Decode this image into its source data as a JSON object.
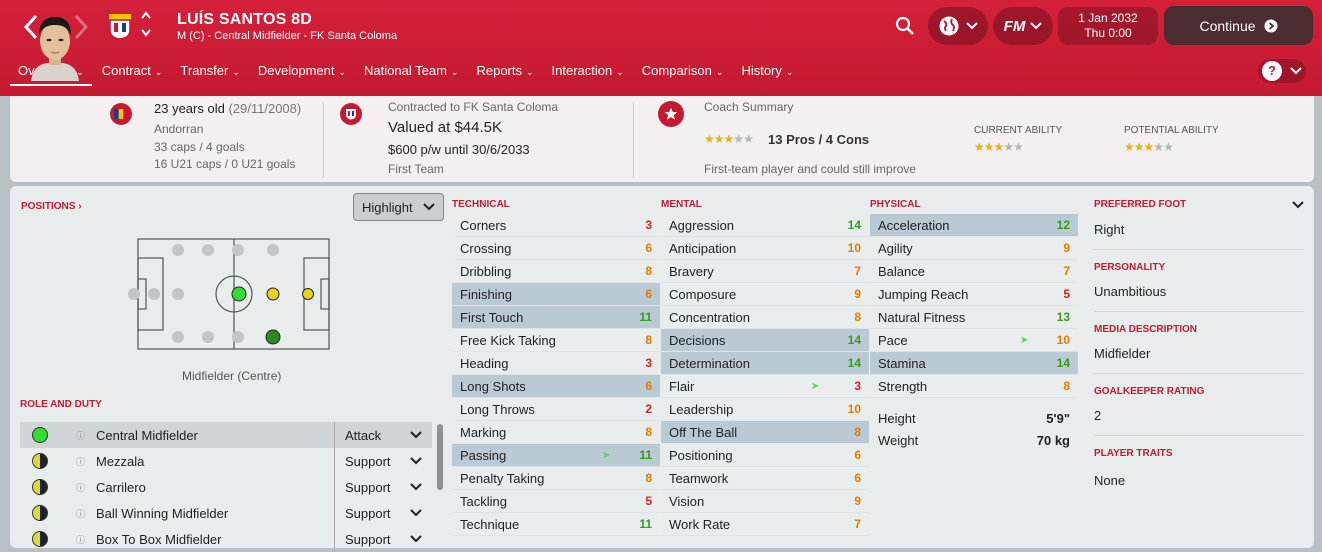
{
  "header": {
    "player_name": "LUÍS SANTOS 8D",
    "subtitle": "M (C) - Central Midfielder - FK Santa Coloma",
    "date": "1 Jan 2032",
    "day_time": "Thu 0:00",
    "continue_label": "Continue",
    "fm_label": "FM"
  },
  "tabs": [
    "Overview",
    "Contract",
    "Transfer",
    "Development",
    "National Team",
    "Reports",
    "Interaction",
    "Comparison",
    "History"
  ],
  "info": {
    "age": "23 years old",
    "dob": "(29/11/2008)",
    "nationality": "Andorran",
    "caps": "33 caps / 4 goals",
    "u21_caps": "16 U21 caps / 0 U21 goals",
    "contracted_to": "Contracted to FK Santa Coloma",
    "value": "Valued at $44.5K",
    "wage": "$600 p/w until 30/6/2033",
    "squad_status": "First Team",
    "coach_title": "Coach Summary",
    "coach_rating": 3,
    "pros_cons": "13 Pros / 4 Cons",
    "coach_note": "First-team player and could still improve",
    "ca_label": "CURRENT ABILITY",
    "ca_stars": 3,
    "pa_label": "POTENTIAL ABILITY",
    "pa_stars": 3
  },
  "positions": {
    "title": "POSITIONS",
    "highlight_label": "Highlight",
    "position_label": "Midfielder (Centre)"
  },
  "roles": {
    "title": "ROLE AND DUTY",
    "items": [
      {
        "name": "Central Midfielder",
        "duty": "Attack",
        "color": "#33dd33"
      },
      {
        "name": "Mezzala",
        "duty": "Support",
        "color": "#d6dd33"
      },
      {
        "name": "Carrilero",
        "duty": "Support",
        "color": "#d6dd33"
      },
      {
        "name": "Ball Winning Midfielder",
        "duty": "Support",
        "color": "#d6dd33"
      },
      {
        "name": "Box To Box Midfielder",
        "duty": "Support",
        "color": "#d6dd33"
      }
    ]
  },
  "technical": {
    "title": "TECHNICAL",
    "items": [
      {
        "name": "Corners",
        "value": "3"
      },
      {
        "name": "Crossing",
        "value": "6"
      },
      {
        "name": "Dribbling",
        "value": "8"
      },
      {
        "name": "Finishing",
        "value": "6"
      },
      {
        "name": "First Touch",
        "value": "11"
      },
      {
        "name": "Free Kick Taking",
        "value": "8"
      },
      {
        "name": "Heading",
        "value": "3"
      },
      {
        "name": "Long Shots",
        "value": "6"
      },
      {
        "name": "Long Throws",
        "value": "2"
      },
      {
        "name": "Marking",
        "value": "8"
      },
      {
        "name": "Passing",
        "value": "11"
      },
      {
        "name": "Penalty Taking",
        "value": "8"
      },
      {
        "name": "Tackling",
        "value": "5"
      },
      {
        "name": "Technique",
        "value": "11"
      }
    ]
  },
  "mental": {
    "title": "MENTAL",
    "items": [
      {
        "name": "Aggression",
        "value": "14"
      },
      {
        "name": "Anticipation",
        "value": "10"
      },
      {
        "name": "Bravery",
        "value": "7"
      },
      {
        "name": "Composure",
        "value": "9"
      },
      {
        "name": "Concentration",
        "value": "8"
      },
      {
        "name": "Decisions",
        "value": "14"
      },
      {
        "name": "Determination",
        "value": "14"
      },
      {
        "name": "Flair",
        "value": "3"
      },
      {
        "name": "Leadership",
        "value": "10"
      },
      {
        "name": "Off The Ball",
        "value": "8"
      },
      {
        "name": "Positioning",
        "value": "6"
      },
      {
        "name": "Teamwork",
        "value": "6"
      },
      {
        "name": "Vision",
        "value": "9"
      },
      {
        "name": "Work Rate",
        "value": "7"
      }
    ]
  },
  "physical": {
    "title": "PHYSICAL",
    "items": [
      {
        "name": "Acceleration",
        "value": "12"
      },
      {
        "name": "Agility",
        "value": "9"
      },
      {
        "name": "Balance",
        "value": "7"
      },
      {
        "name": "Jumping Reach",
        "value": "5"
      },
      {
        "name": "Natural Fitness",
        "value": "13"
      },
      {
        "name": "Pace",
        "value": "10"
      },
      {
        "name": "Stamina",
        "value": "14"
      },
      {
        "name": "Strength",
        "value": "8"
      }
    ],
    "height_label": "Height",
    "height": "5'9\"",
    "weight_label": "Weight",
    "weight": "70 kg"
  },
  "details": {
    "preferred_foot_label": "PREFERRED FOOT",
    "preferred_foot": "Right",
    "personality_label": "PERSONALITY",
    "personality": "Unambitious",
    "media_label": "MEDIA DESCRIPTION",
    "media": "Midfielder",
    "gk_label": "GOALKEEPER RATING",
    "gk": "2",
    "traits_label": "PLAYER TRAITS",
    "traits": "None"
  },
  "colors": {
    "brand_red": "#c41a31",
    "attr_low": "#d0231f",
    "attr_mid": "#e07b00",
    "attr_high": "#3a9a1f"
  }
}
